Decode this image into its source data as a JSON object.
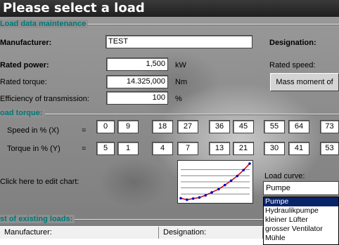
{
  "window": {
    "title": "Please select a load"
  },
  "sections": {
    "maintenance": "Load data maintenance",
    "torque": "oad torque:",
    "existing": "st of existing loads:"
  },
  "form": {
    "manufacturer_label": "Manufacturer:",
    "manufacturer_value": "TEST",
    "designation_label": "Designation:",
    "rated_power_label": "Rated power:",
    "rated_power_value": "1,500",
    "rated_power_unit": "kW",
    "rated_speed_label": "Rated speed:",
    "rated_torque_label": "Rated torque:",
    "rated_torque_value": "14.325,000",
    "rated_torque_unit": "Nm",
    "efficiency_label": "Efficiency of transmission:",
    "efficiency_value": "100",
    "efficiency_unit": "%",
    "mass_moment_button": "Mass moment of"
  },
  "torque": {
    "speed_label": "Speed in % (X)",
    "torque_label": "Torque in % (Y)",
    "eq": "=",
    "speed_values": [
      "0",
      "9",
      "18",
      "27",
      "36",
      "45",
      "55",
      "64",
      "73"
    ],
    "torque_values": [
      "5",
      "1",
      "4",
      "7",
      "13",
      "21",
      "30",
      "41",
      "53"
    ]
  },
  "chart": {
    "edit_label": "Click here to edit chart:",
    "chart_data": {
      "type": "line",
      "x": [
        0,
        9,
        18,
        27,
        36,
        45,
        55,
        64,
        73,
        82,
        91,
        100
      ],
      "y": [
        5,
        1,
        4,
        7,
        13,
        21,
        30,
        41,
        53,
        66,
        82,
        100
      ],
      "line_color": "#cc0000",
      "marker_color": "#0000cc"
    }
  },
  "load_curve": {
    "label": "Load curve:",
    "selected": "Pumpe",
    "options": [
      "Pumpe",
      "Hydraulikpumpe",
      "kleiner Lüfter",
      "grosser Ventilator",
      "Mühle"
    ]
  },
  "table": {
    "columns": [
      "Manufacturer:",
      "Designation:"
    ]
  }
}
